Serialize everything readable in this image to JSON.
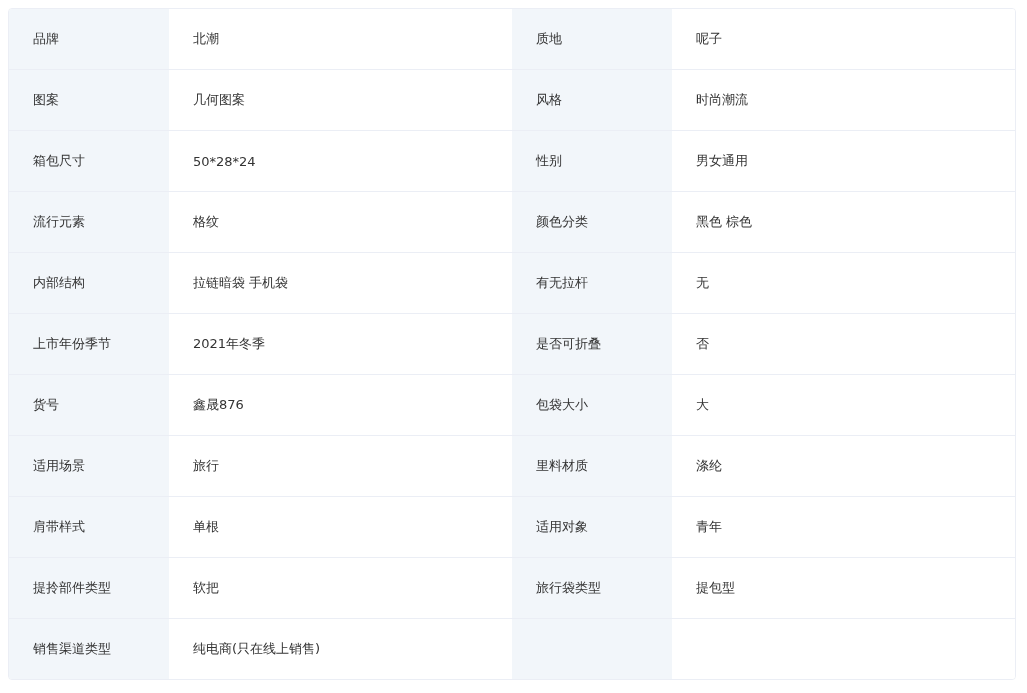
{
  "specs": [
    {
      "pairs": [
        {
          "label": "品牌",
          "value": "北潮"
        },
        {
          "label": "质地",
          "value": "呢子"
        }
      ]
    },
    {
      "pairs": [
        {
          "label": "图案",
          "value": "几何图案"
        },
        {
          "label": "风格",
          "value": "时尚潮流"
        }
      ]
    },
    {
      "pairs": [
        {
          "label": "箱包尺寸",
          "value": "50*28*24"
        },
        {
          "label": "性别",
          "value": "男女通用"
        }
      ]
    },
    {
      "pairs": [
        {
          "label": "流行元素",
          "value": "格纹"
        },
        {
          "label": "颜色分类",
          "value": "黑色 棕色"
        }
      ]
    },
    {
      "pairs": [
        {
          "label": "内部结构",
          "value": "拉链暗袋 手机袋"
        },
        {
          "label": "有无拉杆",
          "value": "无"
        }
      ]
    },
    {
      "pairs": [
        {
          "label": "上市年份季节",
          "value": "2021年冬季"
        },
        {
          "label": "是否可折叠",
          "value": "否"
        }
      ]
    },
    {
      "pairs": [
        {
          "label": "货号",
          "value": "鑫晟876"
        },
        {
          "label": "包袋大小",
          "value": "大"
        }
      ]
    },
    {
      "pairs": [
        {
          "label": "适用场景",
          "value": "旅行"
        },
        {
          "label": "里料材质",
          "value": "涤纶"
        }
      ]
    },
    {
      "pairs": [
        {
          "label": "肩带样式",
          "value": "单根"
        },
        {
          "label": "适用对象",
          "value": "青年"
        }
      ]
    },
    {
      "pairs": [
        {
          "label": "提拎部件类型",
          "value": "软把"
        },
        {
          "label": "旅行袋类型",
          "value": "提包型"
        }
      ]
    },
    {
      "pairs": [
        {
          "label": "销售渠道类型",
          "value": "纯电商(只在线上销售)"
        }
      ]
    }
  ]
}
